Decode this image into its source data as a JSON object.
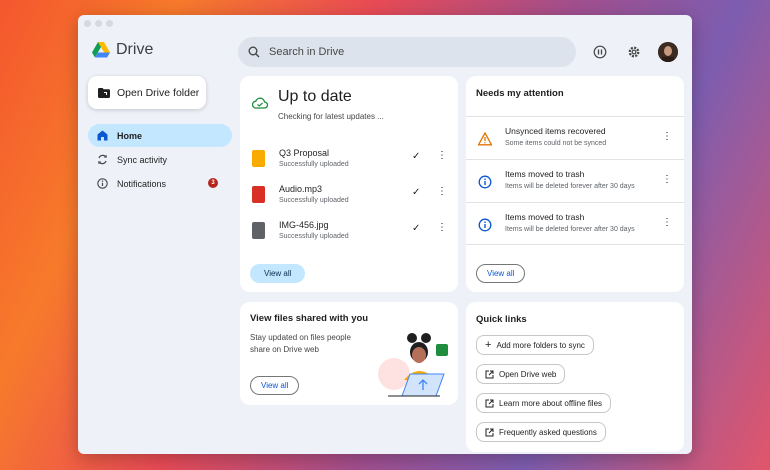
{
  "app": {
    "title": "Drive"
  },
  "search": {
    "placeholder": "Search in Drive"
  },
  "sidebar": {
    "open_folder_label": "Open Drive folder",
    "items": [
      {
        "label": "Home",
        "icon": "home-icon",
        "active": true
      },
      {
        "label": "Sync activity",
        "icon": "sync-icon"
      },
      {
        "label": "Notifications",
        "icon": "info-icon",
        "badge": "3"
      }
    ]
  },
  "sync": {
    "title": "Up to date",
    "subtitle": "Checking for latest updates ...",
    "files": [
      {
        "name": "Q3 Proposal",
        "status": "Successfully uploaded",
        "color": "#f9ab00"
      },
      {
        "name": "Audio.mp3",
        "status": "Successfully uploaded",
        "color": "#d93025"
      },
      {
        "name": "IMG-456.jpg",
        "status": "Successfully uploaded",
        "color": "#5f6368"
      }
    ],
    "view_all": "View all"
  },
  "attention": {
    "title": "Needs my attention",
    "items": [
      {
        "title": "Unsynced items recovered",
        "subtitle": "Some items could not be synced",
        "icon": "warning-icon"
      },
      {
        "title": "Items moved to trash",
        "subtitle": "Items will be deleted forever after 30 days",
        "icon": "info-icon"
      },
      {
        "title": "Items moved to trash",
        "subtitle": "Items will be deleted forever after 30 days",
        "icon": "info-icon"
      }
    ],
    "view_all": "View all"
  },
  "shared": {
    "title": "View files shared with you",
    "description": "Stay updated on files people share on Drive web",
    "view_all": "View all"
  },
  "quick_links": {
    "title": "Quick links",
    "items": [
      {
        "label": "Add more folders to sync",
        "icon": "plus-icon"
      },
      {
        "label": "Open Drive web",
        "icon": "external-link-icon"
      },
      {
        "label": "Learn more about offline files",
        "icon": "external-link-icon"
      },
      {
        "label": "Frequently asked questions",
        "icon": "external-link-icon"
      }
    ]
  },
  "colors": {
    "accent": "#c2e7ff",
    "badge": "#b3261e",
    "warning": "#e37400",
    "info": "#0b57d0"
  }
}
